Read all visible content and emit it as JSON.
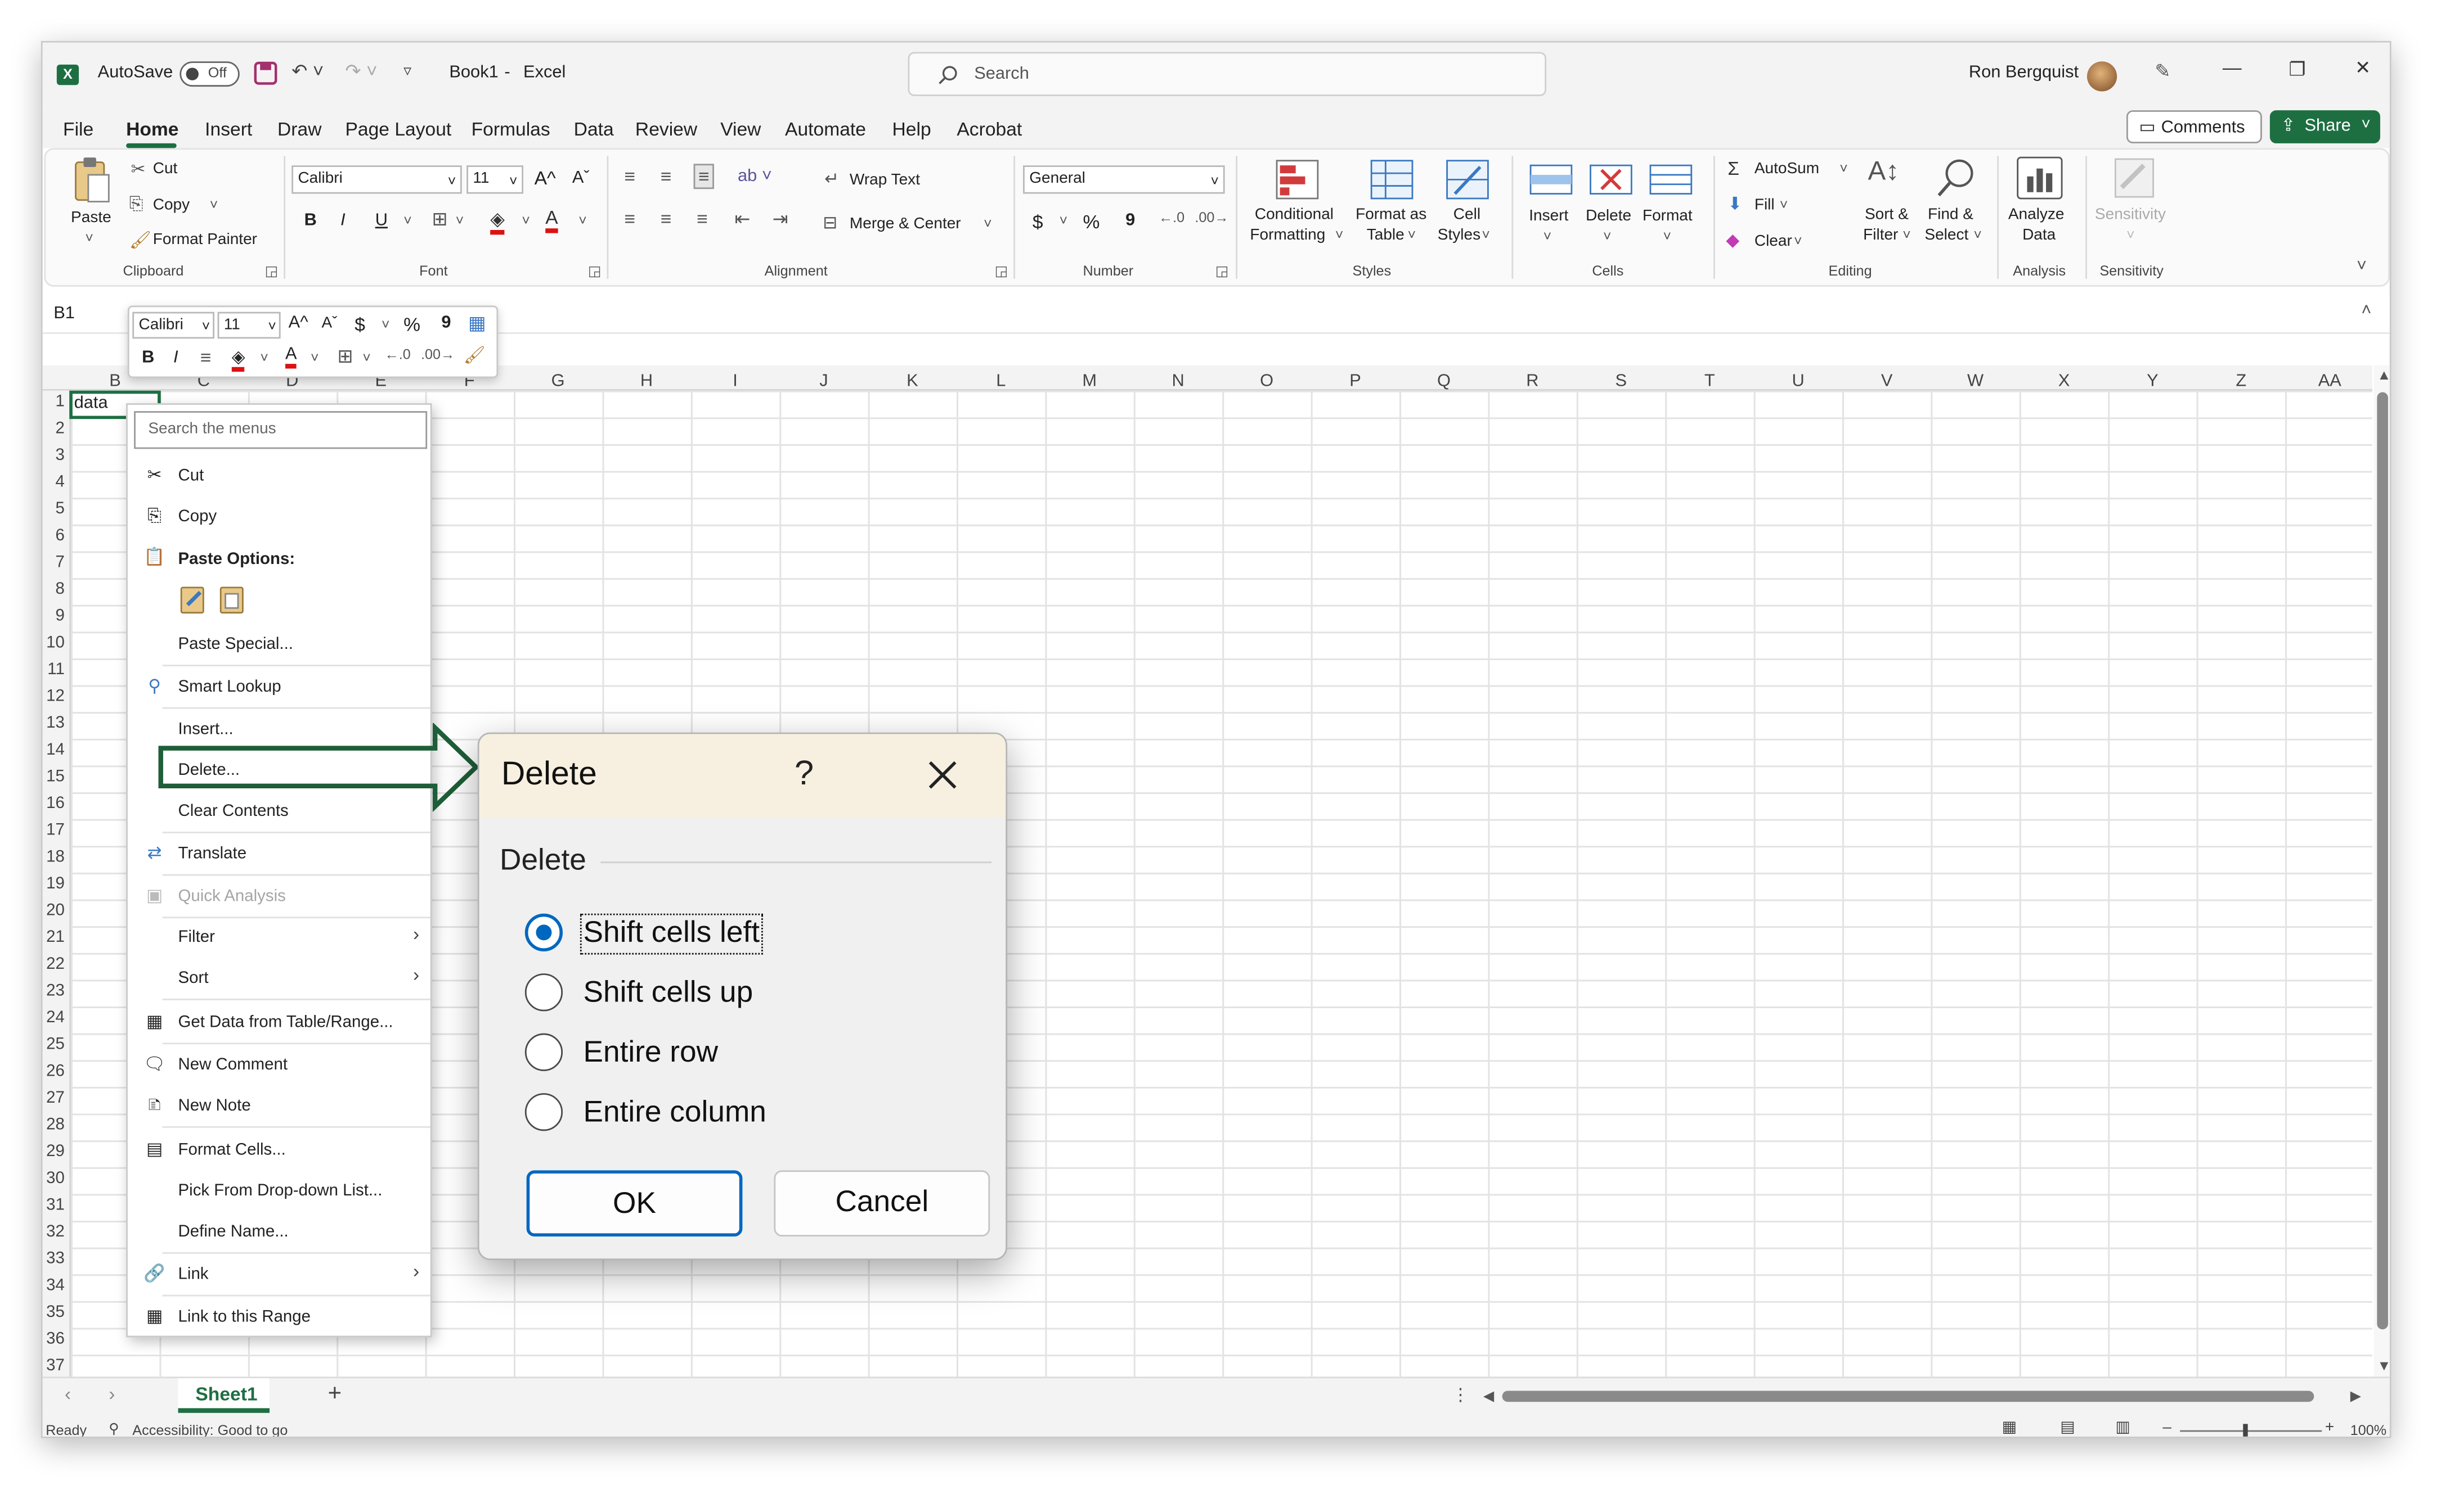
{
  "titlebar": {
    "autosave_label": "AutoSave",
    "autosave_state": "Off",
    "document": "Book1",
    "separator": "-",
    "app": "Excel",
    "search_placeholder": "Search",
    "user": "Ron Bergquist"
  },
  "menu_tabs": [
    "File",
    "Home",
    "Insert",
    "Draw",
    "Page Layout",
    "Formulas",
    "Data",
    "Review",
    "View",
    "Automate",
    "Help",
    "Acrobat"
  ],
  "active_tab": "Home",
  "header_buttons": {
    "comments": "Comments",
    "share": "Share"
  },
  "ribbon": {
    "clipboard": {
      "paste": "Paste",
      "cut": "Cut",
      "copy": "Copy",
      "format_painter": "Format Painter",
      "label": "Clipboard"
    },
    "font": {
      "name": "Calibri",
      "size": "11",
      "label": "Font",
      "bold": "B",
      "italic": "I",
      "underline": "U"
    },
    "alignment": {
      "wrap_text": "Wrap Text",
      "merge_center": "Merge & Center",
      "label": "Alignment"
    },
    "number": {
      "format": "General",
      "label": "Number",
      "currency": "$",
      "percent": "%",
      "comma": "9"
    },
    "styles": {
      "conditional_formatting_1": "Conditional",
      "conditional_formatting_2": "Formatting",
      "format_as_table_1": "Format as",
      "format_as_table_2": "Table",
      "cell_styles_1": "Cell",
      "cell_styles_2": "Styles",
      "label": "Styles"
    },
    "cells": {
      "insert": "Insert",
      "delete": "Delete",
      "format": "Format",
      "label": "Cells"
    },
    "editing": {
      "autosum": "AutoSum",
      "fill": "Fill",
      "clear": "Clear",
      "sort_filter_1": "Sort &",
      "sort_filter_2": "Filter",
      "find_select_1": "Find &",
      "find_select_2": "Select",
      "label": "Editing"
    },
    "analysis": {
      "analyze_1": "Analyze",
      "analyze_2": "Data",
      "label": "Analysis"
    },
    "sensitivity": {
      "button": "Sensitivity",
      "label": "Sensitivity"
    }
  },
  "name_box": "B1",
  "mini_toolbar": {
    "font": "Calibri",
    "size": "11",
    "bold": "B",
    "italic": "I",
    "currency": "$",
    "percent": "%",
    "comma": "9"
  },
  "columns": [
    "B",
    "C",
    "D",
    "E",
    "F",
    "G",
    "H",
    "I",
    "J",
    "K",
    "L",
    "M",
    "N",
    "O",
    "P",
    "Q",
    "R",
    "S",
    "T",
    "U",
    "V",
    "W",
    "X",
    "Y",
    "Z",
    "AA"
  ],
  "rows": [
    "1",
    "2",
    "3",
    "4",
    "5",
    "6",
    "7",
    "8",
    "9",
    "10",
    "11",
    "12",
    "13",
    "14",
    "15",
    "16",
    "17",
    "18",
    "19",
    "20",
    "21",
    "22",
    "23",
    "24",
    "25",
    "26",
    "27",
    "28",
    "29",
    "30",
    "31",
    "32",
    "33",
    "34",
    "35",
    "36",
    "37"
  ],
  "cell_b1": "data",
  "context_menu": {
    "search_placeholder": "Search the menus",
    "cut": "Cut",
    "copy": "Copy",
    "paste_options": "Paste Options:",
    "paste_special": "Paste Special...",
    "smart_lookup": "Smart Lookup",
    "insert": "Insert...",
    "delete": "Delete...",
    "clear_contents": "Clear Contents",
    "translate": "Translate",
    "quick_analysis": "Quick Analysis",
    "filter": "Filter",
    "sort": "Sort",
    "get_data": "Get Data from Table/Range...",
    "new_comment": "New Comment",
    "new_note": "New Note",
    "format_cells": "Format Cells...",
    "pick_list": "Pick From Drop-down List...",
    "define_name": "Define Name...",
    "link": "Link",
    "link_range": "Link to this Range"
  },
  "dialog": {
    "title": "Delete",
    "help": "?",
    "group": "Delete",
    "options": [
      "Shift cells left",
      "Shift cells up",
      "Entire row",
      "Entire column"
    ],
    "selected": "Shift cells left",
    "ok": "OK",
    "cancel": "Cancel"
  },
  "sheet_tabs": [
    "Sheet1"
  ],
  "status": {
    "ready": "Ready",
    "accessibility": "Accessibility: Good to go",
    "zoom": "100%"
  },
  "colors": {
    "excel_green": "#1d6f42",
    "accent_blue": "#0067c0",
    "callout_green": "#1e5e38"
  }
}
